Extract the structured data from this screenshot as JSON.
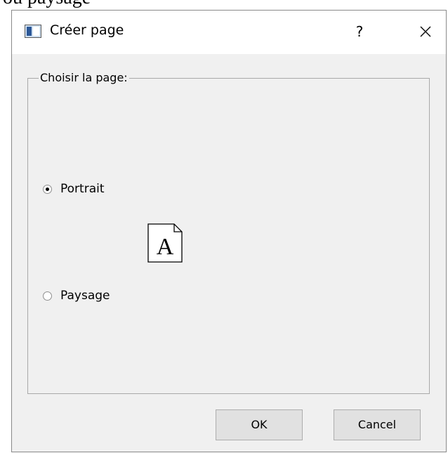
{
  "background": {
    "doc_text": "ou paysage"
  },
  "dialog": {
    "title": "Créer page",
    "help_label": "?",
    "group_label": "Choisir la page:",
    "options": [
      {
        "label": "Portrait",
        "checked": true
      },
      {
        "label": "Paysage",
        "checked": false
      }
    ],
    "preview_letter": "A",
    "ok_label": "OK",
    "cancel_label": "Cancel"
  }
}
